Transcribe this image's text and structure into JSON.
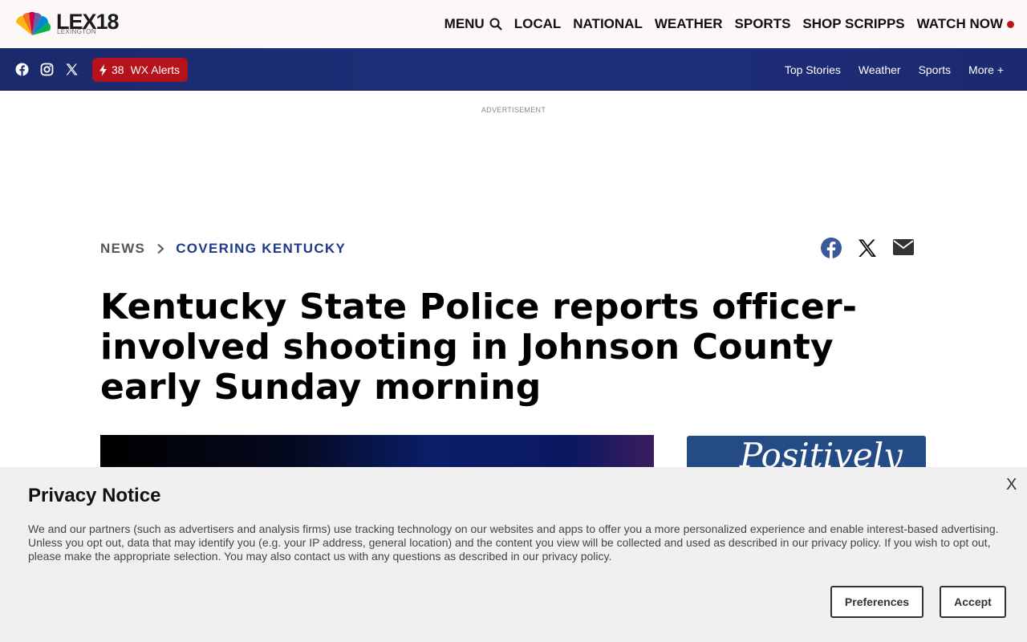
{
  "logo": {
    "name": "LEX18",
    "subtitle": "LEXINGTON"
  },
  "top_nav": {
    "menu_label": "MENU",
    "items": [
      "LOCAL",
      "NATIONAL",
      "WEATHER",
      "SPORTS",
      "SHOP SCRIPPS"
    ],
    "watch_label": "WATCH NOW"
  },
  "alert_bar": {
    "social_icons": [
      "facebook-icon",
      "instagram-icon",
      "x-icon"
    ],
    "wx_count": "38",
    "wx_label": "WX Alerts",
    "sub_nav": [
      "Top Stories",
      "Weather",
      "Sports",
      "More +"
    ]
  },
  "ad": {
    "label": "ADVERTISEMENT"
  },
  "breadcrumb": {
    "section": "NEWS",
    "subsection": "COVERING KENTUCKY"
  },
  "share_icons": [
    "facebook-icon",
    "x-icon",
    "email-icon"
  ],
  "article": {
    "headline": "Kentucky State Police reports officer-involved shooting in Johnson County early Sunday morning"
  },
  "side_ad": {
    "text": "Positively"
  },
  "privacy": {
    "title": "Privacy Notice",
    "close_label": "X",
    "body": "We and our partners (such as advertisers and analysis firms) use tracking technology on our websites and apps to offer you a more personalized experience and enable interest-based advertising. Unless you opt out, data that may identify you (e.g. your IP address, general location) and the content you view will be collected and used as described in our privacy policy. If you wish to opt out, please make the appropriate selection. You may also contact us with any questions as described in our privacy policy.",
    "preferences_label": "Preferences",
    "accept_label": "Accept"
  },
  "colors": {
    "brand_blue": "#1e2f7a",
    "alert_red": "#b5121b",
    "breadcrumb_blue": "#1e3a8a"
  }
}
